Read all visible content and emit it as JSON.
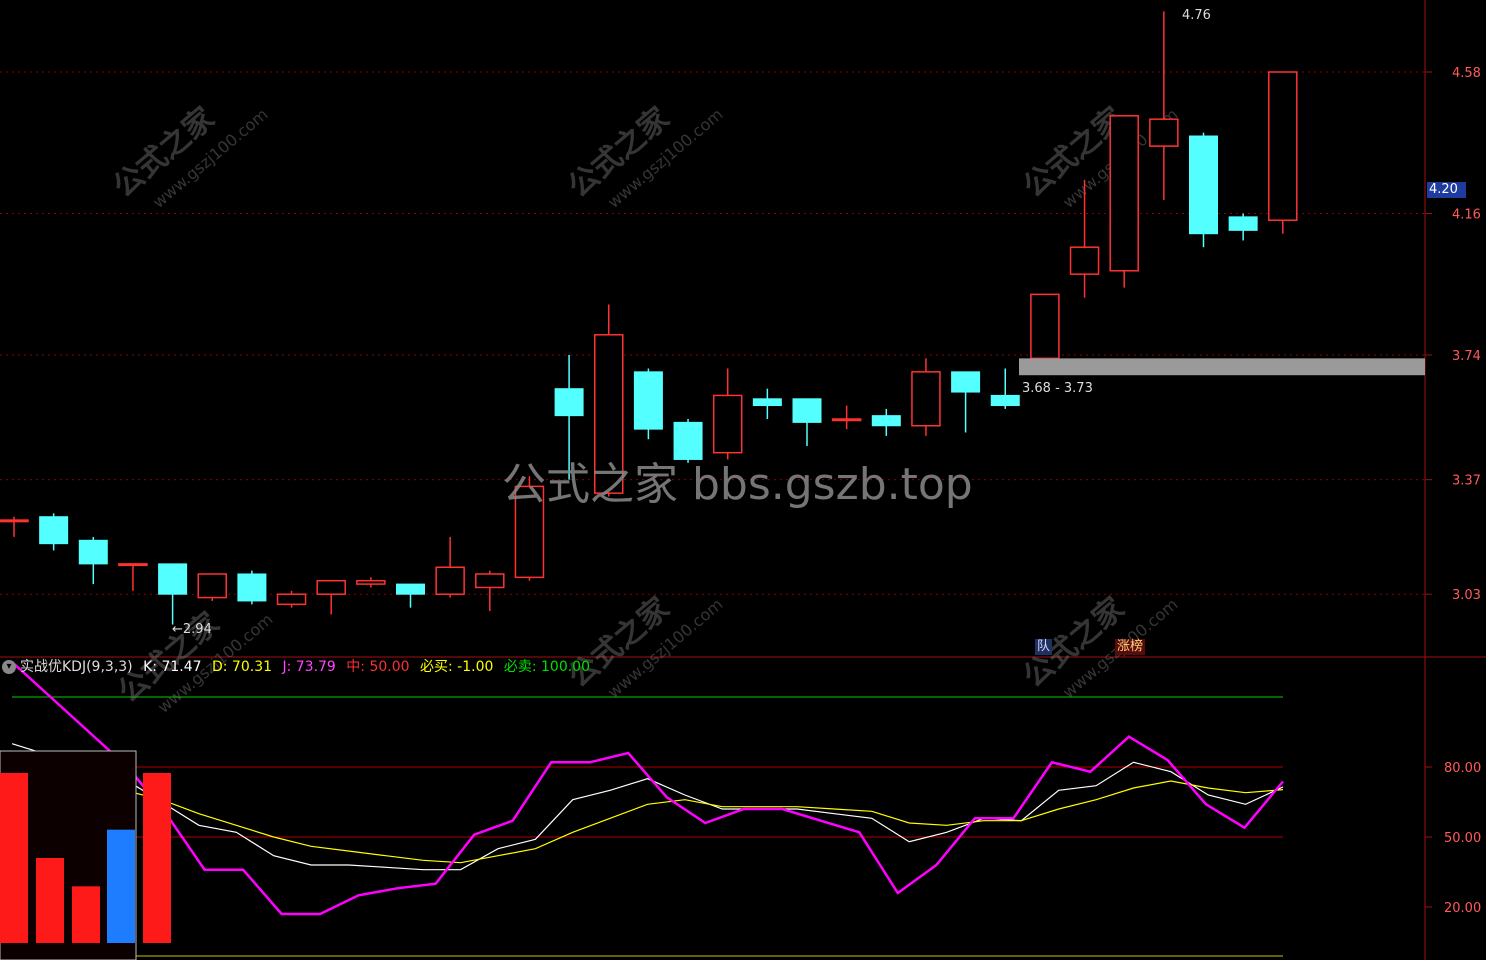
{
  "indicator": {
    "name": "实战优KDJ(9,3,3)",
    "k_label": "K: 71.47",
    "d_label": "D: 70.31",
    "j_label": "J: 73.79",
    "mid_label": "中: 50.00",
    "buy_label": "必买: -1.00",
    "sell_label": "必卖: 100.00"
  },
  "price_tags": {
    "high": "4.76",
    "low": "2.94",
    "zone": "3.68 - 3.73",
    "current": "4.20"
  },
  "badges": {
    "limit_up": "涨榜",
    "mark": "队"
  },
  "watermark": {
    "main": "公式之家 bbs.gszb.top",
    "diag_cn": "公式之家",
    "diag_url": "www.gszj100.com"
  },
  "colors": {
    "up": "#ff3232",
    "down": "#54ffff",
    "k_line": "#ffffff",
    "d_line": "#ffff00",
    "j_line": "#ff00ff",
    "grid": "#8b0000"
  },
  "chart_data": [
    {
      "type": "candlestick",
      "y_axis_ticks": [
        "4.58",
        "4.16",
        "3.74",
        "3.37",
        "3.03"
      ],
      "ylim": [
        2.87,
        4.78
      ],
      "candles": [
        {
          "o": 3.25,
          "h": 3.26,
          "l": 3.2,
          "c": 3.25
        },
        {
          "o": 3.26,
          "h": 3.27,
          "l": 3.16,
          "c": 3.18
        },
        {
          "o": 3.19,
          "h": 3.2,
          "l": 3.06,
          "c": 3.12
        },
        {
          "o": 3.12,
          "h": 3.12,
          "l": 3.04,
          "c": 3.12
        },
        {
          "o": 3.12,
          "h": 3.12,
          "l": 2.94,
          "c": 3.03
        },
        {
          "o": 3.02,
          "h": 3.09,
          "l": 3.01,
          "c": 3.09
        },
        {
          "o": 3.09,
          "h": 3.1,
          "l": 3.0,
          "c": 3.01
        },
        {
          "o": 3.0,
          "h": 3.04,
          "l": 2.99,
          "c": 3.03
        },
        {
          "o": 3.03,
          "h": 3.07,
          "l": 2.97,
          "c": 3.07
        },
        {
          "o": 3.06,
          "h": 3.08,
          "l": 3.05,
          "c": 3.07
        },
        {
          "o": 3.06,
          "h": 3.06,
          "l": 2.99,
          "c": 3.03
        },
        {
          "o": 3.03,
          "h": 3.2,
          "l": 3.02,
          "c": 3.11
        },
        {
          "o": 3.05,
          "h": 3.1,
          "l": 2.98,
          "c": 3.09
        },
        {
          "o": 3.08,
          "h": 3.38,
          "l": 3.07,
          "c": 3.35
        },
        {
          "o": 3.64,
          "h": 3.74,
          "l": 3.37,
          "c": 3.56
        },
        {
          "o": 3.33,
          "h": 3.89,
          "l": 3.32,
          "c": 3.8
        },
        {
          "o": 3.69,
          "h": 3.7,
          "l": 3.49,
          "c": 3.52
        },
        {
          "o": 3.54,
          "h": 3.55,
          "l": 3.42,
          "c": 3.43
        },
        {
          "o": 3.45,
          "h": 3.7,
          "l": 3.43,
          "c": 3.62
        },
        {
          "o": 3.61,
          "h": 3.64,
          "l": 3.55,
          "c": 3.59
        },
        {
          "o": 3.61,
          "h": 3.61,
          "l": 3.47,
          "c": 3.54
        },
        {
          "o": 3.55,
          "h": 3.59,
          "l": 3.52,
          "c": 3.55
        },
        {
          "o": 3.56,
          "h": 3.58,
          "l": 3.5,
          "c": 3.53
        },
        {
          "o": 3.53,
          "h": 3.73,
          "l": 3.5,
          "c": 3.69
        },
        {
          "o": 3.69,
          "h": 3.69,
          "l": 3.51,
          "c": 3.63
        },
        {
          "o": 3.62,
          "h": 3.7,
          "l": 3.58,
          "c": 3.59
        },
        {
          "o": 3.73,
          "h": 3.92,
          "l": 3.73,
          "c": 3.92
        },
        {
          "o": 3.98,
          "h": 4.26,
          "l": 3.91,
          "c": 4.06
        },
        {
          "o": 3.99,
          "h": 4.45,
          "l": 3.94,
          "c": 4.45
        },
        {
          "o": 4.36,
          "h": 4.76,
          "l": 4.2,
          "c": 4.44
        },
        {
          "o": 4.39,
          "h": 4.4,
          "l": 4.06,
          "c": 4.1
        },
        {
          "o": 4.15,
          "h": 4.16,
          "l": 4.08,
          "c": 4.11
        },
        {
          "o": 4.14,
          "h": 4.58,
          "l": 4.1,
          "c": 4.58
        }
      ]
    },
    {
      "type": "line",
      "y_axis_ticks": [
        "80.00",
        "50.00",
        "20.00"
      ],
      "ylim": [
        0,
        125
      ],
      "reference_lines": [
        110,
        80,
        50,
        0
      ],
      "series": [
        {
          "name": "K",
          "values": [
            90,
            85,
            80,
            75,
            65,
            55,
            52,
            42,
            38,
            38,
            37,
            36,
            36,
            45,
            49,
            66,
            70,
            75,
            68,
            62,
            62,
            62,
            60,
            58,
            48,
            52,
            58,
            57,
            70,
            72,
            82,
            78,
            68,
            64,
            71.47
          ]
        },
        {
          "name": "D",
          "values": [
            82,
            80,
            75,
            70,
            66,
            60,
            55,
            50,
            46,
            44,
            42,
            40,
            39,
            42,
            45,
            52,
            58,
            64,
            66,
            63,
            63,
            63,
            62,
            61,
            56,
            55,
            57,
            57,
            62,
            66,
            71,
            74,
            71,
            69,
            70.31
          ]
        },
        {
          "name": "J",
          "values": [
            125,
            110,
            95,
            80,
            60,
            36,
            36,
            17,
            17,
            25,
            28,
            30,
            51,
            57,
            82,
            82,
            86,
            67,
            56,
            62,
            62,
            57,
            52,
            26,
            38,
            58,
            58,
            82,
            78,
            93,
            83,
            64,
            54,
            73.79
          ]
        }
      ]
    },
    {
      "type": "bar",
      "values": [
        6,
        3,
        2,
        4,
        6
      ]
    }
  ]
}
